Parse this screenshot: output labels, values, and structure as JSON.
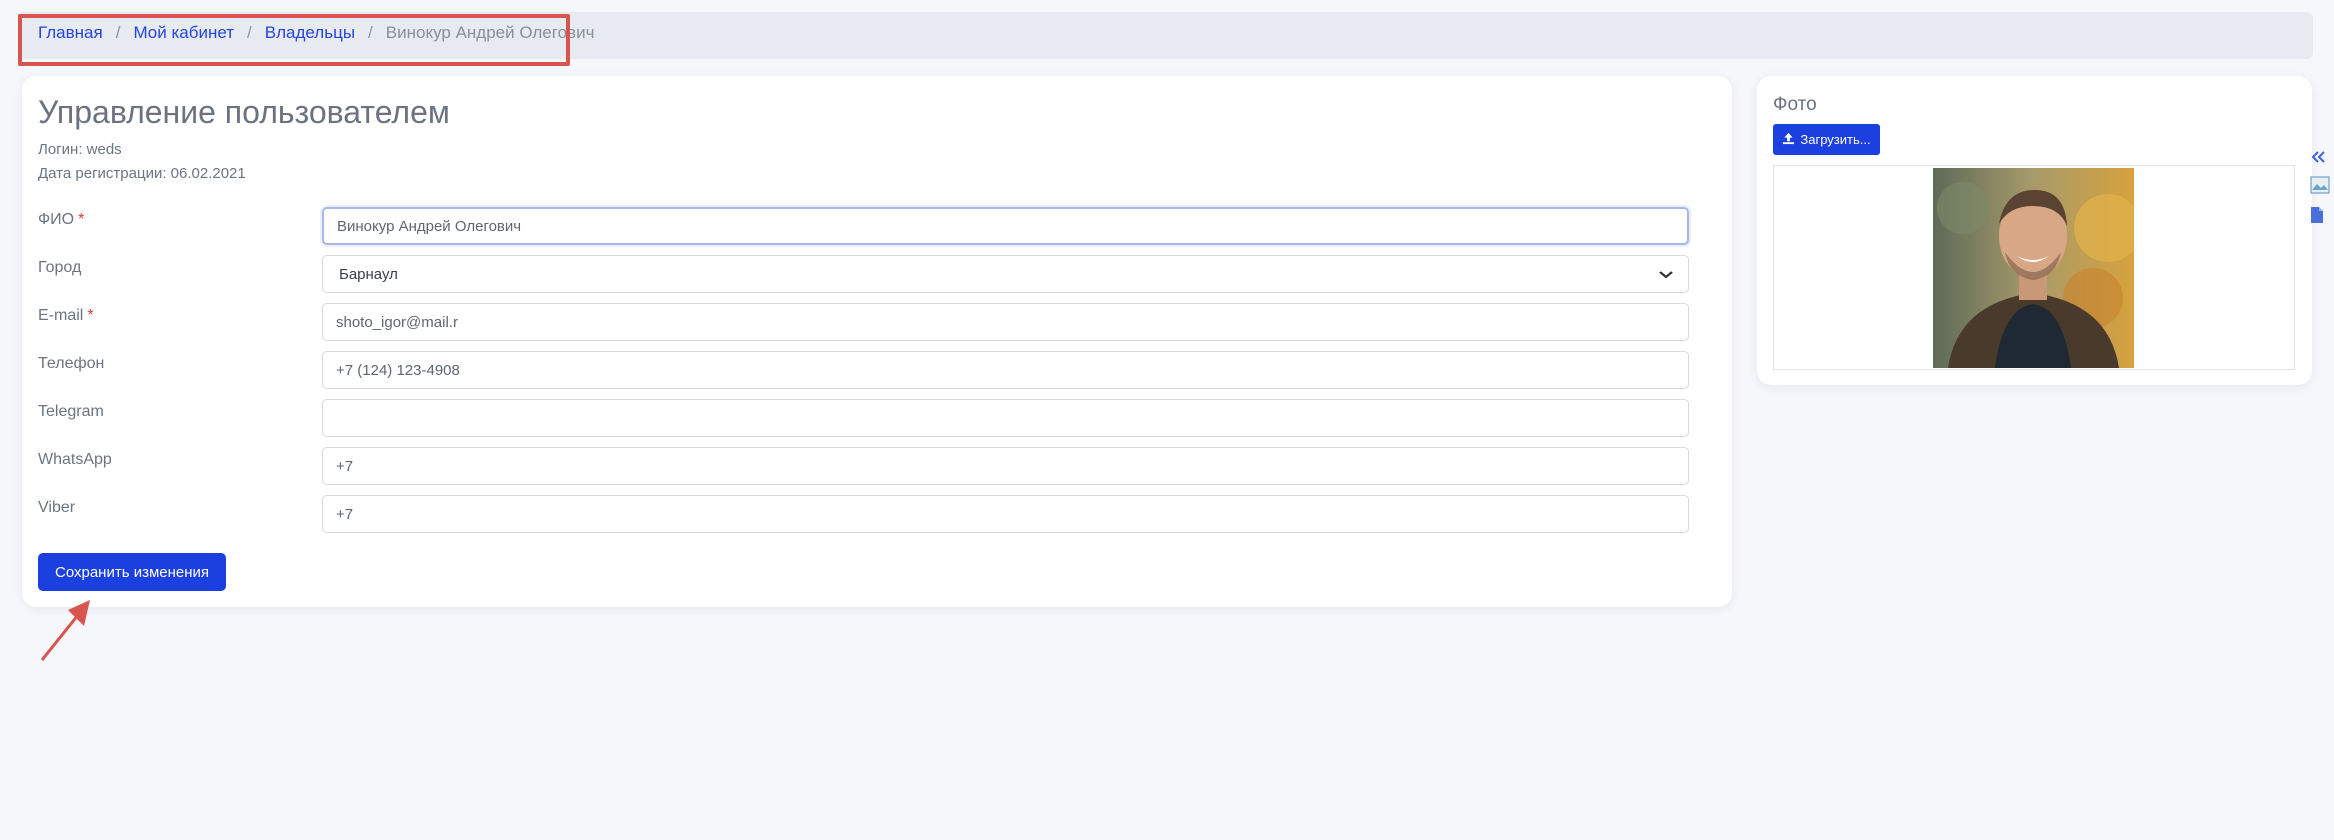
{
  "breadcrumb": {
    "items": [
      {
        "label": "Главная"
      },
      {
        "label": "Мой кабинет"
      },
      {
        "label": "Владельцы"
      }
    ],
    "current": "Винокур Андрей Олегович",
    "separator": "/"
  },
  "page": {
    "title": "Управление пользователем",
    "login": "Логин: weds",
    "registration_date": "Дата регистрации: 06.02.2021"
  },
  "form": {
    "fields": [
      {
        "label": "ФИО",
        "required": "*",
        "value": "Винокур Андрей Олегович",
        "placeholder": ""
      },
      {
        "label": "Город",
        "value": "Барнаул"
      },
      {
        "label": "E-mail",
        "required": "*",
        "value": "shoto_igor@mail.r",
        "placeholder": ""
      },
      {
        "label": "Телефон",
        "value": "+7 (124) 123-4908",
        "placeholder": ""
      },
      {
        "label": "Telegram",
        "value": "",
        "placeholder": ""
      },
      {
        "label": "WhatsApp",
        "value": "+7",
        "placeholder": ""
      },
      {
        "label": "Viber",
        "value": "+7",
        "placeholder": ""
      }
    ],
    "save_label": "Сохранить изменения"
  },
  "photo_panel": {
    "title": "Фото",
    "upload_label": "Загрузить..."
  },
  "icons": {
    "upload": "upload-icon",
    "collapse": "double-chevron-left-icon",
    "image": "image-icon",
    "document": "document-icon",
    "select_caret": "chevron-down-icon"
  },
  "colors": {
    "primary": "#1c3fe0",
    "link": "#2545d8",
    "required": "#e03c3c",
    "annotation": "#d9534f",
    "background": "#f6f7fb"
  }
}
